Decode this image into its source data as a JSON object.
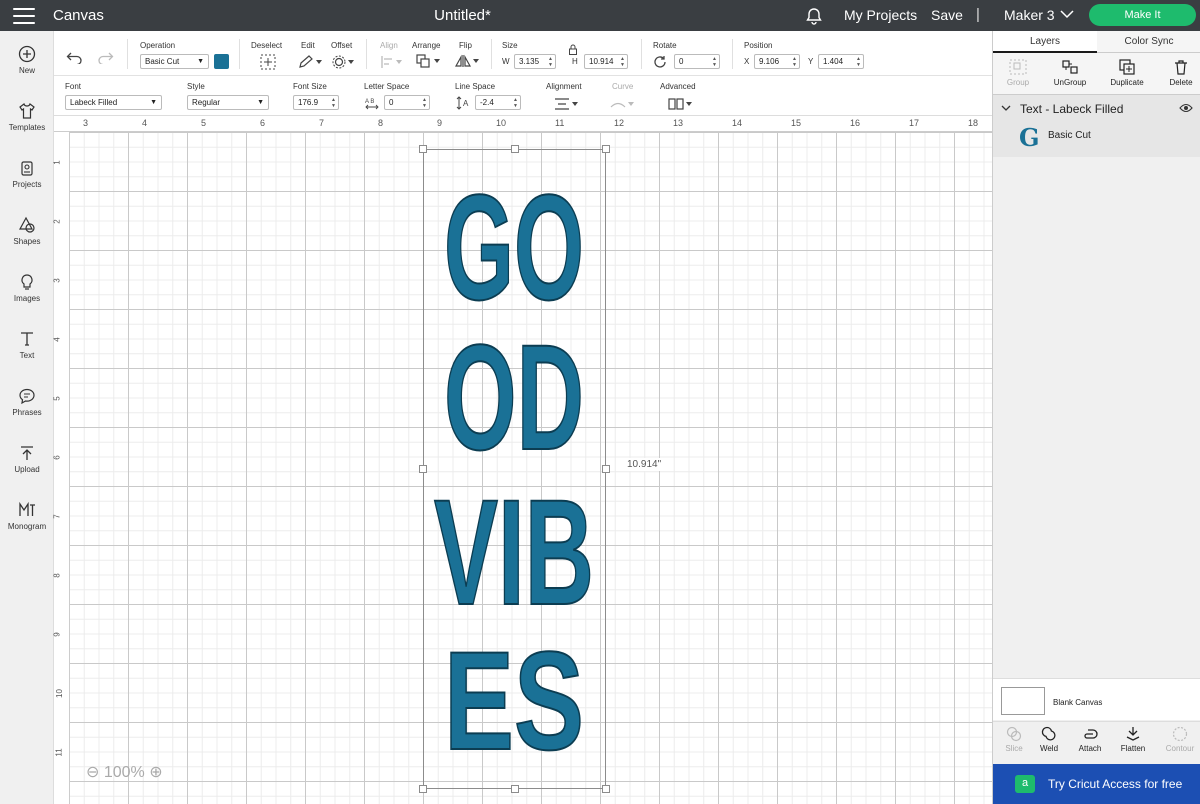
{
  "topbar": {
    "app_title": "Canvas",
    "document_title": "Untitled*",
    "my_projects": "My Projects",
    "save": "Save",
    "separator": "|",
    "machine": "Maker 3",
    "make_it": "Make It"
  },
  "sidebar": {
    "items": [
      {
        "label": "New",
        "icon": "plus-circle-icon"
      },
      {
        "label": "Templates",
        "icon": "shirt-icon"
      },
      {
        "label": "Projects",
        "icon": "projects-icon"
      },
      {
        "label": "Shapes",
        "icon": "shapes-icon"
      },
      {
        "label": "Images",
        "icon": "lightbulb-icon"
      },
      {
        "label": "Text",
        "icon": "text-icon"
      },
      {
        "label": "Phrases",
        "icon": "speech-bubble-icon"
      },
      {
        "label": "Upload",
        "icon": "upload-icon"
      },
      {
        "label": "Monogram",
        "icon": "monogram-icon"
      }
    ]
  },
  "toolbar": {
    "operation_label": "Operation",
    "operation_value": "Basic Cut",
    "operation_color": "#1a7196",
    "deselect_label": "Deselect",
    "edit_label": "Edit",
    "offset_label": "Offset",
    "align_label": "Align",
    "arrange_label": "Arrange",
    "flip_label": "Flip",
    "size_label": "Size",
    "w_label": "W",
    "w_value": "3.135",
    "h_label": "H",
    "h_value": "10.914",
    "rotate_label": "Rotate",
    "rotate_value": "0",
    "position_label": "Position",
    "x_label": "X",
    "x_value": "9.106",
    "y_label": "Y",
    "y_value": "1.404"
  },
  "text_toolbar": {
    "font_label": "Font",
    "font_value": "Labeck Filled",
    "style_label": "Style",
    "style_value": "Regular",
    "font_size_label": "Font Size",
    "font_size_value": "176.9",
    "letter_space_label": "Letter Space",
    "letter_space_value": "0",
    "line_space_label": "Line Space",
    "line_space_value": "-2.4",
    "alignment_label": "Alignment",
    "curve_label": "Curve",
    "advanced_label": "Advanced"
  },
  "rulers": {
    "top": [
      "3",
      "4",
      "5",
      "6",
      "7",
      "8",
      "9",
      "10",
      "11",
      "12",
      "13",
      "14",
      "15",
      "16",
      "17",
      "18"
    ],
    "left": [
      "1",
      "2",
      "3",
      "4",
      "5",
      "6",
      "7",
      "8",
      "9",
      "10",
      "11"
    ]
  },
  "canvas": {
    "lines": [
      "GO",
      "OD",
      "VIB",
      "ES"
    ],
    "text_color": "#1a7196",
    "dimension_label": "10.914\"",
    "zoom": "100%"
  },
  "panel": {
    "tabs": [
      "Layers",
      "Color Sync"
    ],
    "actions": {
      "group": "Group",
      "ungroup": "UnGroup",
      "duplicate": "Duplicate",
      "delete": "Delete"
    },
    "layer_group_name": "Text - Labeck Filled",
    "layer_icon_glyph": "G",
    "layer_item_name": "Basic Cut",
    "blank_canvas": "Blank Canvas",
    "bottom_actions": {
      "slice": "Slice",
      "weld": "Weld",
      "attach": "Attach",
      "flatten": "Flatten",
      "contour": "Contour"
    },
    "access_badge": "a",
    "access_text": "Try Cricut Access for free"
  }
}
